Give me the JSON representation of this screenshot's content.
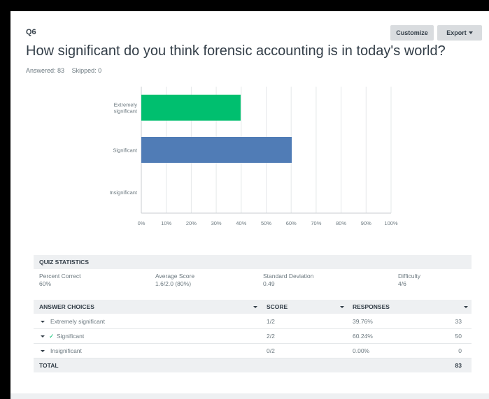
{
  "question": {
    "number": "Q6",
    "title": "How significant do you think forensic accounting is in today's world?",
    "answered": "Answered: 83",
    "skipped": "Skipped: 0"
  },
  "toolbar": {
    "customize_label": "Customize",
    "export_label": "Export"
  },
  "colors": {
    "green": "#00bf6f",
    "blue": "#507cb6",
    "grid": "#e5e8ea"
  },
  "chart_data": {
    "type": "bar",
    "orientation": "horizontal",
    "categories": [
      "Extremely significant",
      "Significant",
      "Insignificant"
    ],
    "values": [
      39.76,
      60.24,
      0
    ],
    "bar_colors": [
      "#00bf6f",
      "#507cb6",
      "#507cb6"
    ],
    "xlim": [
      0,
      100
    ],
    "x_ticks": [
      "0%",
      "10%",
      "20%",
      "30%",
      "40%",
      "50%",
      "60%",
      "70%",
      "80%",
      "90%",
      "100%"
    ],
    "grid": true
  },
  "quiz_stats": {
    "heading": "QUIZ STATISTICS",
    "percent_correct_label": "Percent Correct",
    "percent_correct_value": "60%",
    "avg_score_label": "Average Score",
    "avg_score_value": "1.6/2.0 (80%)",
    "std_dev_label": "Standard Deviation",
    "std_dev_value": "0.49",
    "difficulty_label": "Difficulty",
    "difficulty_value": "4/6"
  },
  "answers": {
    "headers": {
      "choices": "ANSWER CHOICES",
      "score": "SCORE",
      "responses": "RESPONSES"
    },
    "rows": [
      {
        "label": "Extremely significant",
        "score": "1/2",
        "percent": "39.76%",
        "count": "33",
        "correct": false
      },
      {
        "label": "Significant",
        "score": "2/2",
        "percent": "60.24%",
        "count": "50",
        "correct": true
      },
      {
        "label": "Insignificant",
        "score": "0/2",
        "percent": "0.00%",
        "count": "0",
        "correct": false
      }
    ],
    "total_label": "TOTAL",
    "total_count": "83"
  }
}
